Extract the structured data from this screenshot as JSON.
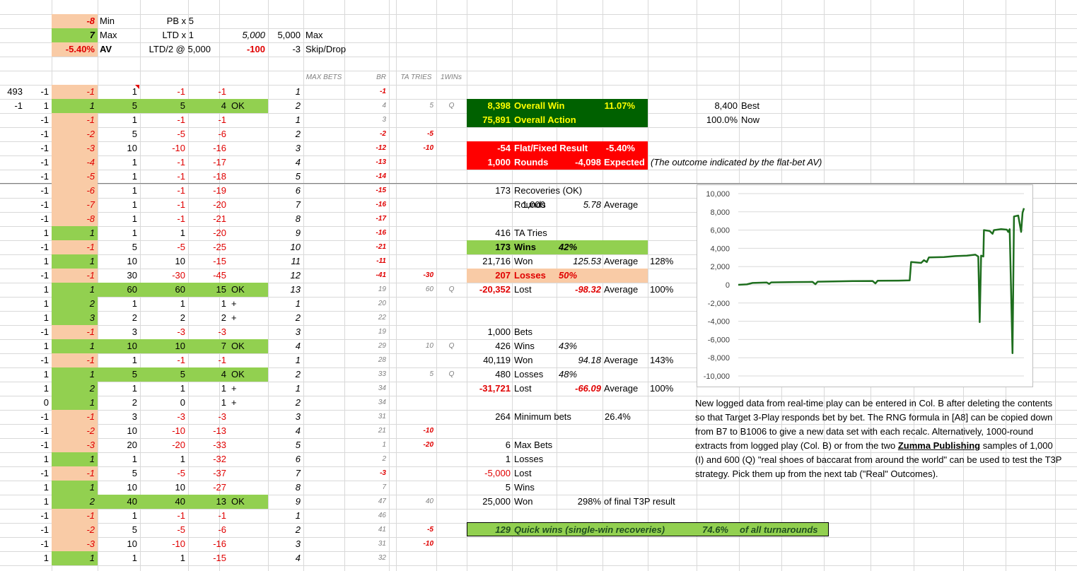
{
  "colors": {
    "peach": "#f9cba6",
    "green": "#92d050",
    "dark_green": "#006100",
    "red": "#ff0000",
    "line": "#1e6e1e"
  },
  "top": {
    "min_val": "-8",
    "min_label": "Min",
    "pb": "PB x 5",
    "max_val": "7",
    "max_label": "Max",
    "ltd": "LTD x 1",
    "ltd_val": "5,000",
    "max_amt": "5,000",
    "max_word": "Max",
    "av_val": "-5.40%",
    "av_label": "AV",
    "ltd2": "LTD/2 @ 5,000",
    "ltd2_val": "-100",
    "skip_val": "-3",
    "skip_label": "Skip/Drop"
  },
  "headers": {
    "max_bets": "MAX BETS",
    "br": "BR",
    "ta_tries": "TA TRIES",
    "wins1": "1WINs"
  },
  "rows": [
    {
      "a": "493",
      "b": "-1",
      "c": "-1",
      "d": "1",
      "e": "-1",
      "f": "-1",
      "g": "",
      "h": "1",
      "i": "-1",
      "j": "",
      "k": "",
      "bg": "p",
      "cred": true,
      "flag": true
    },
    {
      "a": "-1",
      "b": "1",
      "c": "1",
      "d": "5",
      "e": "5",
      "f": "4",
      "g": "OK",
      "h": "2",
      "i": "4",
      "j": "5",
      "k": "Q",
      "bg": "g",
      "cred": false
    },
    {
      "a": "",
      "b": "-1",
      "c": "-1",
      "d": "1",
      "e": "-1",
      "f": "-1",
      "g": "",
      "h": "1",
      "i": "3",
      "j": "",
      "k": "",
      "bg": "p",
      "cred": true
    },
    {
      "a": "",
      "b": "-1",
      "c": "-2",
      "d": "5",
      "e": "-5",
      "f": "-6",
      "g": "",
      "h": "2",
      "i": "-2",
      "j": "-5",
      "k": "",
      "bg": "p",
      "cred": true
    },
    {
      "a": "",
      "b": "-1",
      "c": "-3",
      "d": "10",
      "e": "-10",
      "f": "-16",
      "g": "",
      "h": "3",
      "i": "-12",
      "j": "-10",
      "k": "",
      "bg": "p",
      "cred": true
    },
    {
      "a": "",
      "b": "-1",
      "c": "-4",
      "d": "1",
      "e": "-1",
      "f": "-17",
      "g": "",
      "h": "4",
      "i": "-13",
      "j": "",
      "k": "",
      "bg": "p",
      "cred": true
    },
    {
      "a": "",
      "b": "-1",
      "c": "-5",
      "d": "1",
      "e": "-1",
      "f": "-18",
      "g": "",
      "h": "5",
      "i": "-14",
      "j": "",
      "k": "",
      "bg": "p",
      "cred": true
    },
    {
      "a": "",
      "b": "-1",
      "c": "-6",
      "d": "1",
      "e": "-1",
      "f": "-19",
      "g": "",
      "h": "6",
      "i": "-15",
      "j": "",
      "k": "",
      "bg": "p",
      "cred": true
    },
    {
      "a": "",
      "b": "-1",
      "c": "-7",
      "d": "1",
      "e": "-1",
      "f": "-20",
      "g": "",
      "h": "7",
      "i": "-16",
      "j": "",
      "k": "",
      "bg": "p",
      "cred": true
    },
    {
      "a": "",
      "b": "-1",
      "c": "-8",
      "d": "1",
      "e": "-1",
      "f": "-21",
      "g": "",
      "h": "8",
      "i": "-17",
      "j": "",
      "k": "",
      "bg": "p",
      "cred": true
    },
    {
      "a": "",
      "b": "1",
      "c": "1",
      "d": "1",
      "e": "1",
      "f": "-20",
      "g": "",
      "h": "9",
      "i": "-16",
      "j": "",
      "k": "",
      "bg": "g",
      "cred": false
    },
    {
      "a": "",
      "b": "-1",
      "c": "-1",
      "d": "5",
      "e": "-5",
      "f": "-25",
      "g": "",
      "h": "10",
      "i": "-21",
      "j": "",
      "k": "",
      "bg": "p",
      "cred": true
    },
    {
      "a": "",
      "b": "1",
      "c": "1",
      "d": "10",
      "e": "10",
      "f": "-15",
      "g": "",
      "h": "11",
      "i": "-11",
      "j": "",
      "k": "",
      "bg": "g",
      "cred": false
    },
    {
      "a": "",
      "b": "-1",
      "c": "-1",
      "d": "30",
      "e": "-30",
      "f": "-45",
      "g": "",
      "h": "12",
      "i": "-41",
      "j": "-30",
      "k": "",
      "bg": "p",
      "cred": true
    },
    {
      "a": "",
      "b": "1",
      "c": "1",
      "d": "60",
      "e": "60",
      "f": "15",
      "g": "OK",
      "h": "13",
      "i": "19",
      "j": "60",
      "k": "Q",
      "bg": "g",
      "cred": false
    },
    {
      "a": "",
      "b": "1",
      "c": "2",
      "d": "1",
      "e": "1",
      "f": "1",
      "g": "+",
      "h": "1",
      "i": "20",
      "j": "",
      "k": "",
      "bg": "g",
      "cred": false
    },
    {
      "a": "",
      "b": "1",
      "c": "3",
      "d": "2",
      "e": "2",
      "f": "2",
      "g": "+",
      "h": "2",
      "i": "22",
      "j": "",
      "k": "",
      "bg": "g",
      "cred": false
    },
    {
      "a": "",
      "b": "-1",
      "c": "-1",
      "d": "3",
      "e": "-3",
      "f": "-3",
      "g": "",
      "h": "3",
      "i": "19",
      "j": "",
      "k": "",
      "bg": "p",
      "cred": true
    },
    {
      "a": "",
      "b": "1",
      "c": "1",
      "d": "10",
      "e": "10",
      "f": "7",
      "g": "OK",
      "h": "4",
      "i": "29",
      "j": "10",
      "k": "Q",
      "bg": "g",
      "cred": false
    },
    {
      "a": "",
      "b": "-1",
      "c": "-1",
      "d": "1",
      "e": "-1",
      "f": "-1",
      "g": "",
      "h": "1",
      "i": "28",
      "j": "",
      "k": "",
      "bg": "p",
      "cred": true
    },
    {
      "a": "",
      "b": "1",
      "c": "1",
      "d": "5",
      "e": "5",
      "f": "4",
      "g": "OK",
      "h": "2",
      "i": "33",
      "j": "5",
      "k": "Q",
      "bg": "g",
      "cred": false
    },
    {
      "a": "",
      "b": "1",
      "c": "2",
      "d": "1",
      "e": "1",
      "f": "1",
      "g": "+",
      "h": "1",
      "i": "34",
      "j": "",
      "k": "",
      "bg": "g",
      "cred": false
    },
    {
      "a": "",
      "b": "0",
      "c": "1",
      "d": "2",
      "e": "0",
      "f": "1",
      "g": "+",
      "h": "2",
      "i": "34",
      "j": "",
      "k": "",
      "bg": "g",
      "cred": false
    },
    {
      "a": "",
      "b": "-1",
      "c": "-1",
      "d": "3",
      "e": "-3",
      "f": "-3",
      "g": "",
      "h": "3",
      "i": "31",
      "j": "",
      "k": "",
      "bg": "p",
      "cred": true
    },
    {
      "a": "",
      "b": "-1",
      "c": "-2",
      "d": "10",
      "e": "-10",
      "f": "-13",
      "g": "",
      "h": "4",
      "i": "21",
      "j": "-10",
      "k": "",
      "bg": "p",
      "cred": true
    },
    {
      "a": "",
      "b": "-1",
      "c": "-3",
      "d": "20",
      "e": "-20",
      "f": "-33",
      "g": "",
      "h": "5",
      "i": "1",
      "j": "-20",
      "k": "",
      "bg": "p",
      "cred": true
    },
    {
      "a": "",
      "b": "1",
      "c": "1",
      "d": "1",
      "e": "1",
      "f": "-32",
      "g": "",
      "h": "6",
      "i": "2",
      "j": "",
      "k": "",
      "bg": "g",
      "cred": false
    },
    {
      "a": "",
      "b": "-1",
      "c": "-1",
      "d": "5",
      "e": "-5",
      "f": "-37",
      "g": "",
      "h": "7",
      "i": "-3",
      "j": "",
      "k": "",
      "bg": "p",
      "cred": true
    },
    {
      "a": "",
      "b": "1",
      "c": "1",
      "d": "10",
      "e": "10",
      "f": "-27",
      "g": "",
      "h": "8",
      "i": "7",
      "j": "",
      "k": "",
      "bg": "g",
      "cred": false
    },
    {
      "a": "",
      "b": "1",
      "c": "2",
      "d": "40",
      "e": "40",
      "f": "13",
      "g": "OK",
      "h": "9",
      "i": "47",
      "j": "40",
      "k": "",
      "bg": "g",
      "cred": false
    },
    {
      "a": "",
      "b": "-1",
      "c": "-1",
      "d": "1",
      "e": "-1",
      "f": "-1",
      "g": "",
      "h": "1",
      "i": "46",
      "j": "",
      "k": "",
      "bg": "p",
      "cred": true
    },
    {
      "a": "",
      "b": "-1",
      "c": "-2",
      "d": "5",
      "e": "-5",
      "f": "-6",
      "g": "",
      "h": "2",
      "i": "41",
      "j": "-5",
      "k": "",
      "bg": "p",
      "cred": true
    },
    {
      "a": "",
      "b": "-1",
      "c": "-3",
      "d": "10",
      "e": "-10",
      "f": "-16",
      "g": "",
      "h": "3",
      "i": "31",
      "j": "-10",
      "k": "",
      "bg": "p",
      "cred": true
    },
    {
      "a": "",
      "b": "1",
      "c": "1",
      "d": "1",
      "e": "1",
      "f": "-15",
      "g": "",
      "h": "4",
      "i": "32",
      "j": "",
      "k": "",
      "bg": "g",
      "cred": false
    }
  ],
  "summary": {
    "overall_win_val": "8,398",
    "overall_win_label": "Overall Win",
    "overall_win_pct": "11.07%",
    "overall_action_val": "75,891",
    "overall_action_label": "Overall Action",
    "best_val": "8,400",
    "best_label": "Best",
    "now_val": "100.0%",
    "now_label": "Now",
    "flat_val": "-54",
    "flat_label": "Flat/Fixed Result",
    "flat_pct": "-5.40%",
    "rounds_val": "1,000",
    "rounds_label": "Rounds",
    "expected_val": "-4,098",
    "expected_label": "Expected",
    "outcome_note": "(The outcome indicated by the flat-bet AV)",
    "recov_val": "173",
    "recov_label": "Recoveries (OK)",
    "rounds2_val": "1,000",
    "rounds2_label": "Rounds",
    "rounds2_avg": "5.78",
    "avg_label": "Average",
    "ta_val": "416",
    "ta_label": "TA Tries",
    "wins_val": "173",
    "wins_label": "Wins",
    "wins_pct": "42%",
    "won_val": "21,716",
    "won_label": "Won",
    "won_avg": "125.53",
    "won_pct": "128%",
    "losses_val": "207",
    "losses_label": "Losses",
    "losses_pct": "50%",
    "lost_val": "-20,352",
    "lost_label": "Lost",
    "lost_avg": "-98.32",
    "lost_pct": "100%",
    "bets_val": "1,000",
    "bets_label": "Bets",
    "wins2_val": "426",
    "wins2_label": "Wins",
    "wins2_pct": "43%",
    "won2_val": "40,119",
    "won2_label": "Won",
    "won2_avg": "94.18",
    "won2_pct": "143%",
    "losses2_val": "480",
    "losses2_label": "Losses",
    "losses2_pct": "48%",
    "lost2_val": "-31,721",
    "lost2_label": "Lost",
    "lost2_avg": "-66.09",
    "lost2_pct": "100%",
    "minbets_val": "264",
    "minbets_label": "Minimum bets",
    "minbets_pct": "26.4%",
    "maxbets_val": "6",
    "maxbets_label": "Max Bets",
    "mb_losses_val": "1",
    "mb_losses_label": "Losses",
    "mb_lost_val": "-5,000",
    "mb_lost_label": "Lost",
    "mb_wins_val": "5",
    "mb_wins_label": "Wins",
    "mb_won_val": "25,000",
    "mb_won_label": "Won",
    "mb_won_pct": "298%",
    "mb_won_note": "of final T3P result",
    "quick_val": "129",
    "quick_label": "Quick wins (single-win recoveries)",
    "quick_pct": "74.6%",
    "quick_note": "of all turnarounds"
  },
  "note": {
    "p1": "New logged data from real-time play can be entered in Col. B after deleting the contents so that Target 3-Play responds bet by bet.  The RNG formula in [A8] can be copied down from B7 to B1006 to give a new data set with each recalc.  Alternatively, 1000-round extracts from logged play (Col. B) or from the two ",
    "link": "Zumma Publishing",
    "p2": " samples of 1,000 (I) and 600  (Q) \"real shoes of baccarat from around the world\" can be used to test the T3P strategy.  Pick them up from the next tab (\"Real\" Outcomes)."
  },
  "chart_data": {
    "type": "line",
    "ylim": [
      -10000,
      10000
    ],
    "yticks": [
      "10,000",
      "8,000",
      "6,000",
      "4,000",
      "2,000",
      "0",
      "-2,000",
      "-4,000",
      "-6,000",
      "-8,000",
      "-10,000"
    ],
    "grid": true,
    "series": [
      {
        "values": [
          [
            0,
            0
          ],
          [
            30,
            50
          ],
          [
            50,
            200
          ],
          [
            100,
            250
          ],
          [
            108,
            100
          ],
          [
            115,
            260
          ],
          [
            200,
            300
          ],
          [
            260,
            320
          ],
          [
            270,
            60
          ],
          [
            278,
            340
          ],
          [
            400,
            400
          ],
          [
            470,
            420
          ],
          [
            480,
            150
          ],
          [
            488,
            450
          ],
          [
            560,
            460
          ],
          [
            600,
            480
          ],
          [
            605,
            2500
          ],
          [
            640,
            2400
          ],
          [
            650,
            2700
          ],
          [
            660,
            2500
          ],
          [
            667,
            3000
          ],
          [
            720,
            3050
          ],
          [
            760,
            3150
          ],
          [
            800,
            3200
          ],
          [
            830,
            3300
          ],
          [
            840,
            3100
          ],
          [
            845,
            -4100
          ],
          [
            850,
            3200
          ],
          [
            858,
            3100
          ],
          [
            860,
            6000
          ],
          [
            880,
            5900
          ],
          [
            890,
            5600
          ],
          [
            895,
            6000
          ],
          [
            920,
            6100
          ],
          [
            940,
            6050
          ],
          [
            945,
            5800
          ],
          [
            950,
            6100
          ],
          [
            960,
            -7500
          ],
          [
            965,
            7500
          ],
          [
            980,
            7600
          ],
          [
            990,
            5800
          ],
          [
            995,
            7900
          ],
          [
            1000,
            8400
          ]
        ]
      }
    ],
    "x_range": [
      0,
      1000
    ]
  }
}
